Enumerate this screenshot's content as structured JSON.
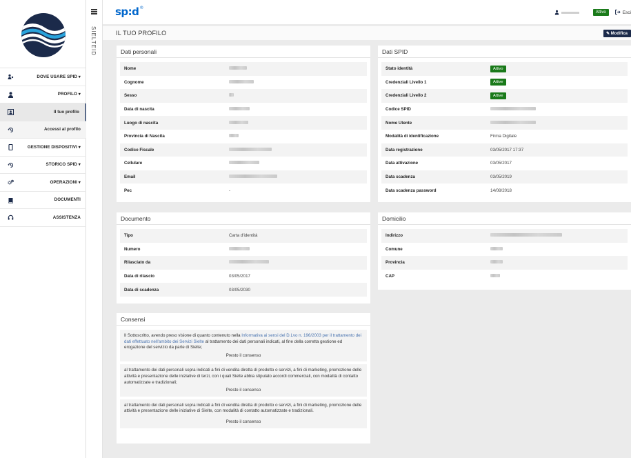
{
  "sidebar": {
    "logo_icon": "sielte-logo",
    "items": [
      {
        "icon": "location-people-icon",
        "label": "DOVE USARE SPID ▾"
      },
      {
        "icon": "user-icon",
        "label": "PROFILO ▾"
      },
      {
        "icon": "id-card-icon",
        "label": "Il tuo profilo"
      },
      {
        "icon": "history-icon",
        "label": "Accessi al profilo"
      },
      {
        "icon": "device-icon",
        "label": "GESTIONE DISPOSITIVI ▾"
      },
      {
        "icon": "history-icon",
        "label": "STORICO SPID ▾"
      },
      {
        "icon": "gears-icon",
        "label": "OPERAZIONI ▾"
      },
      {
        "icon": "book-icon",
        "label": "DOCUMENTI"
      },
      {
        "icon": "headset-icon",
        "label": "ASSISTENZA"
      }
    ]
  },
  "rail": {
    "brand": "SIELTEID"
  },
  "topbar": {
    "logo_text": "sp:d",
    "logo_mark": "®",
    "status": "Attivo",
    "logout": "Esci"
  },
  "header": {
    "title": "IL TUO PROFILO",
    "edit": "Modifica"
  },
  "personal": {
    "title": "Dati personali",
    "rows": [
      {
        "k": "Nome",
        "v": ""
      },
      {
        "k": "Cognome",
        "v": ""
      },
      {
        "k": "Sesso",
        "v": ""
      },
      {
        "k": "Data di nascita",
        "v": ""
      },
      {
        "k": "Luogo di nascita",
        "v": ""
      },
      {
        "k": "Provincia di Nascita",
        "v": ""
      },
      {
        "k": "Codice Fiscale",
        "v": ""
      },
      {
        "k": "Cellulare",
        "v": ""
      },
      {
        "k": "Email",
        "v": ""
      },
      {
        "k": "Pec",
        "v": "-"
      }
    ]
  },
  "spid": {
    "title": "Dati SPID",
    "rows": [
      {
        "k": "Stato identità",
        "badge": "Attivo"
      },
      {
        "k": "Credenziali Livello 1",
        "badge": "Attive"
      },
      {
        "k": "Credenziali Livello 2",
        "badge": "Attive"
      },
      {
        "k": "Codice SPID",
        "v": ""
      },
      {
        "k": "Nome Utente",
        "v": ""
      },
      {
        "k": "Modalità di identificazione",
        "v": "Firma Digitale"
      },
      {
        "k": "Data registrazione",
        "v": "03/05/2017 17:37"
      },
      {
        "k": "Data attivazione",
        "v": "03/05/2017"
      },
      {
        "k": "Data scadenza",
        "v": "03/05/2019"
      },
      {
        "k": "Data scadenza password",
        "v": "14/08/2018"
      }
    ]
  },
  "document": {
    "title": "Documento",
    "rows": [
      {
        "k": "Tipo",
        "v": "Carta d'identità"
      },
      {
        "k": "Numero",
        "v": ""
      },
      {
        "k": "Rilasciato da",
        "v": ""
      },
      {
        "k": "Data di rilascio",
        "v": "03/05/2017"
      },
      {
        "k": "Data di scadenza",
        "v": "03/05/2030"
      }
    ]
  },
  "domicile": {
    "title": "Domicilio",
    "rows": [
      {
        "k": "Indirizzo",
        "v": ""
      },
      {
        "k": "Comune",
        "v": ""
      },
      {
        "k": "Provincia",
        "v": ""
      },
      {
        "k": "CAP",
        "v": ""
      }
    ]
  },
  "consents": {
    "title": "Consensi",
    "c1_pre": "Il Sottoscritto, avendo preso visione di quanto contenuto nella ",
    "c1_link1": "Informativa ai sensi del D.Lvo n. 196/2003 per il trattamento dei dati effettuato nell'ambito dei Servizi Sielte",
    "c1_post": " al trattamento dei dati personali indicati, al fine della corretta gestione ed erogazione del servizio da parte di Sielte;",
    "c2": "al trattamento dei dati personali sopra indicati a fini di vendita diretta di prodotto o servizi, a fini di marketing, promozione delle attività e presentazione delle iniziative di terzi, con i quali Sielte abbia stipulato accordi commerciali, con modalità di contatto automatizzate e tradizionali;",
    "c3": "al trattamento dei dati personali sopra indicati a fini di vendita diretta di prodotto o servizi, a fini di marketing, promozione delle attività e presentazione delle iniziative di Sielte, con modalità di contatto automatizzate e tradizionali.",
    "btn": "Presto il consenso"
  }
}
